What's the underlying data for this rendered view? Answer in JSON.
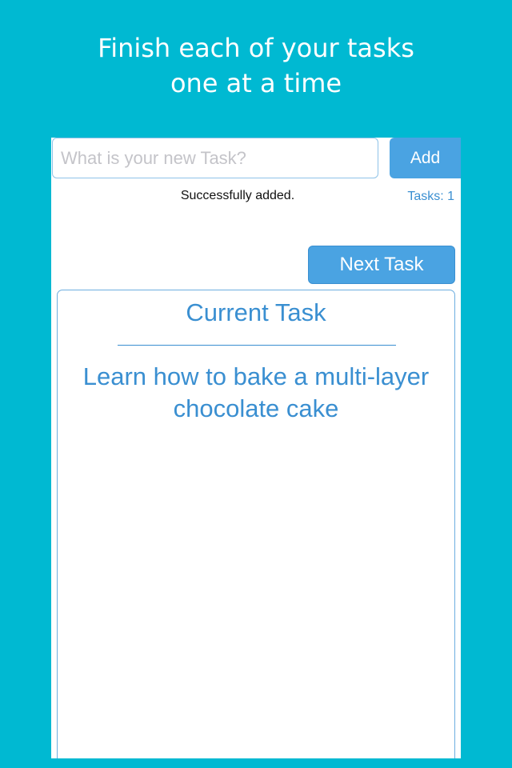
{
  "banner": {
    "line1": "Finish each of your tasks",
    "line2": "one at a time"
  },
  "input": {
    "placeholder": "What is your new Task?",
    "value": ""
  },
  "add_label": "Add",
  "status_message": "Successfully added.",
  "task_count": "Tasks: 1",
  "next_label": "Next Task",
  "current": {
    "heading": "Current Task",
    "task": "Learn how to bake a multi-layer chocolate cake"
  },
  "colors": {
    "background": "#00b9d2",
    "accent": "#3a8fd1",
    "button": "#4aa3e2"
  }
}
